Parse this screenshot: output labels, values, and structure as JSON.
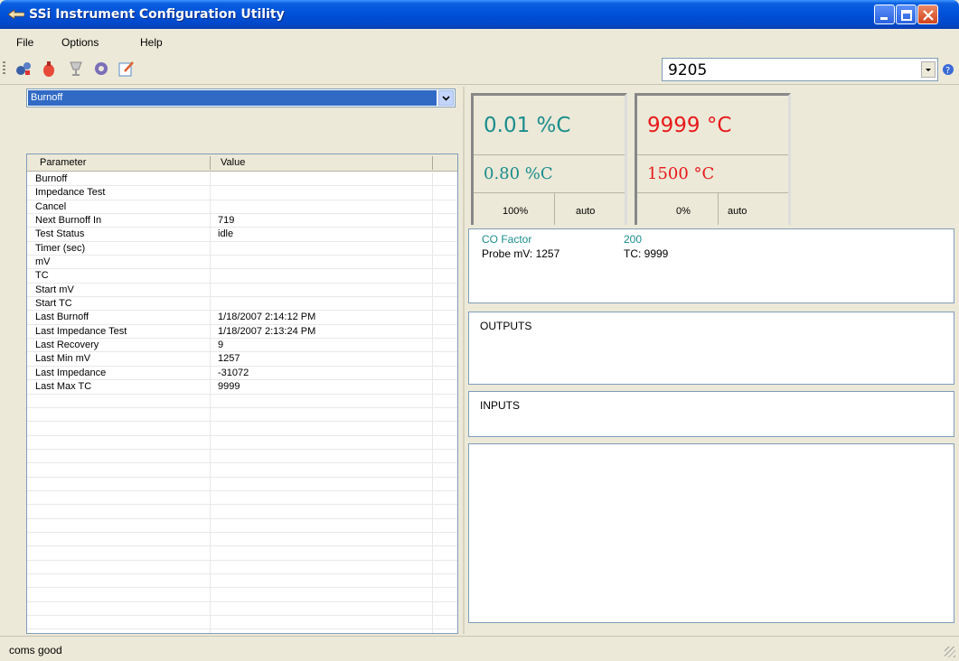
{
  "window": {
    "title": "SSi Instrument Configuration Utility"
  },
  "menu": [
    "File",
    "Options",
    "Help"
  ],
  "toolbar": {
    "icons": [
      "connect-icon",
      "burnoff-icon",
      "cup-icon",
      "gear-icon",
      "edit-icon"
    ],
    "instrument_value": "9205"
  },
  "left": {
    "selected_view": "Burnoff",
    "grid": {
      "headers": [
        "Parameter",
        "Value"
      ],
      "rows": [
        {
          "param": "Burnoff",
          "value": ""
        },
        {
          "param": "Impedance Test",
          "value": ""
        },
        {
          "param": "Cancel",
          "value": ""
        },
        {
          "param": "Next Burnoff In",
          "value": "719"
        },
        {
          "param": "Test Status",
          "value": "idle"
        },
        {
          "param": "Timer (sec)",
          "value": ""
        },
        {
          "param": "mV",
          "value": ""
        },
        {
          "param": "TC",
          "value": ""
        },
        {
          "param": "Start mV",
          "value": ""
        },
        {
          "param": "Start TC",
          "value": ""
        },
        {
          "param": "Last Burnoff",
          "value": "1/18/2007 2:14:12 PM"
        },
        {
          "param": "Last Impedance Test",
          "value": "1/18/2007 2:13:24 PM"
        },
        {
          "param": "Last Recovery",
          "value": "9"
        },
        {
          "param": "Last Min mV",
          "value": "1257"
        },
        {
          "param": "Last Impedance",
          "value": "-31072"
        },
        {
          "param": "Last Max TC",
          "value": "9999"
        }
      ]
    }
  },
  "gauges": [
    {
      "pv": "0.01 %C",
      "sp": "0.80 %C",
      "output": "100%",
      "mode": "auto",
      "color": "#1b8d8d"
    },
    {
      "pv": "9999 °C",
      "sp": "1500 °C",
      "output": "0%",
      "mode": "auto",
      "color": "#e8191b"
    }
  ],
  "info": {
    "co_factor_label": "CO Factor",
    "co_factor_value": "200",
    "probe_mv": "Probe mV: 1257",
    "tc": "TC: 9999"
  },
  "sections": {
    "outputs": "OUTPUTS",
    "inputs": "INPUTS"
  },
  "status": "coms good"
}
